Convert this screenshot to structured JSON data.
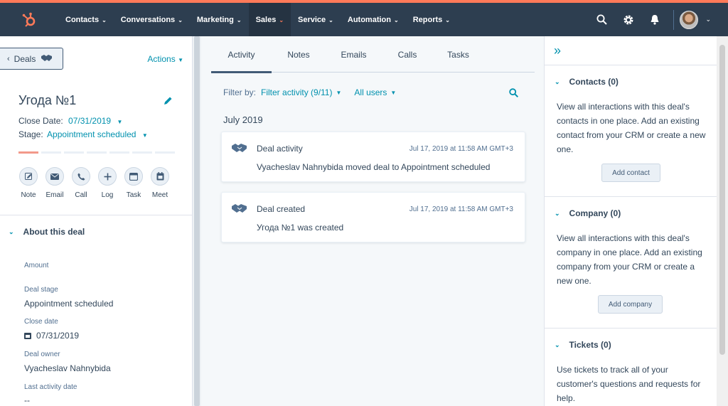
{
  "nav": {
    "items": [
      {
        "label": "Contacts"
      },
      {
        "label": "Conversations"
      },
      {
        "label": "Marketing"
      },
      {
        "label": "Sales"
      },
      {
        "label": "Service"
      },
      {
        "label": "Automation"
      },
      {
        "label": "Reports"
      }
    ],
    "active": "Sales"
  },
  "left": {
    "back_label": "Deals",
    "actions_label": "Actions",
    "deal_title": "Угода №1",
    "close_date_label": "Close Date:",
    "close_date_value": "07/31/2019",
    "stage_label": "Stage:",
    "stage_value": "Appointment scheduled",
    "stage_progress": {
      "completed": 1,
      "total": 7
    },
    "quick_actions": [
      {
        "label": "Note",
        "icon": "pencil-square-icon"
      },
      {
        "label": "Email",
        "icon": "envelope-icon"
      },
      {
        "label": "Call",
        "icon": "phone-icon"
      },
      {
        "label": "Log",
        "icon": "plus-icon"
      },
      {
        "label": "Task",
        "icon": "task-icon"
      },
      {
        "label": "Meet",
        "icon": "calendar-icon"
      }
    ],
    "about_title": "About this deal",
    "properties": {
      "amount_label": "Amount",
      "deal_stage_label": "Deal stage",
      "deal_stage_value": "Appointment scheduled",
      "close_date_label": "Close date",
      "close_date_value": "07/31/2019",
      "deal_owner_label": "Deal owner",
      "deal_owner_value": "Vyacheslav Nahnybida",
      "last_activity_label": "Last activity date",
      "last_activity_value": "--"
    }
  },
  "center": {
    "tabs": [
      {
        "label": "Activity"
      },
      {
        "label": "Notes"
      },
      {
        "label": "Emails"
      },
      {
        "label": "Calls"
      },
      {
        "label": "Tasks"
      }
    ],
    "active_tab": "Activity",
    "filter_by_label": "Filter by:",
    "filter_activity_label": "Filter activity (9/11)",
    "all_users_label": "All users",
    "month_label": "July 2019",
    "cards": [
      {
        "title": "Deal activity",
        "time": "Jul 17, 2019 at 11:58 AM GMT+3",
        "body": "Vyacheslav Nahnybida moved deal to Appointment scheduled"
      },
      {
        "title": "Deal created",
        "time": "Jul 17, 2019 at 11:58 AM GMT+3",
        "body": "Угода №1 was created"
      }
    ]
  },
  "right": {
    "sections": [
      {
        "title": "Contacts (0)",
        "text": "View all interactions with this deal's contacts in one place. Add an existing contact from your CRM or create a new one.",
        "button": "Add contact"
      },
      {
        "title": "Company (0)",
        "text": "View all interactions with this deal's company in one place. Add an existing company from your CRM or create a new one.",
        "button": "Add company"
      },
      {
        "title": "Tickets (0)",
        "text": "Use tickets to track all of your customer's questions and requests for help."
      }
    ]
  },
  "colors": {
    "topbar": "#2d3e50",
    "accent_orange": "#ff7a59",
    "link_teal": "#0091ae",
    "text_dark": "#33475b"
  }
}
